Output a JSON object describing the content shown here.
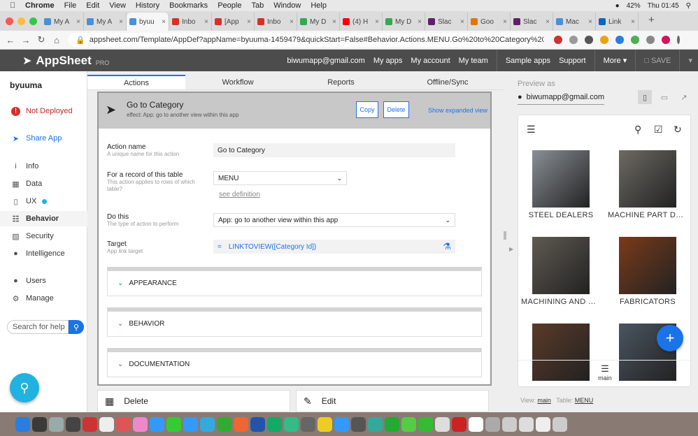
{
  "menubar": {
    "app": "Chrome",
    "items": [
      "File",
      "Edit",
      "View",
      "History",
      "Bookmarks",
      "People",
      "Tab",
      "Window",
      "Help"
    ],
    "battery": "42%",
    "clock": "Thu 01:45"
  },
  "tabs": [
    {
      "label": "My A",
      "color": "#4a90d9"
    },
    {
      "label": "My A",
      "color": "#4a90d9"
    },
    {
      "label": "byuu",
      "color": "#4a90d9",
      "active": true
    },
    {
      "label": "Inbo",
      "color": "#d93025"
    },
    {
      "label": "[App",
      "color": "#d93025"
    },
    {
      "label": "Inbo",
      "color": "#d93025"
    },
    {
      "label": "My D",
      "color": "#34a853"
    },
    {
      "label": "(4) H",
      "color": "#ff0000"
    },
    {
      "label": "My D",
      "color": "#34a853"
    },
    {
      "label": "Slac",
      "color": "#611f69"
    },
    {
      "label": "Goo",
      "color": "#e37400"
    },
    {
      "label": "Slac",
      "color": "#611f69"
    },
    {
      "label": "Mac",
      "color": "#4a90d9"
    },
    {
      "label": "Link",
      "color": "#0a66c2"
    }
  ],
  "address": {
    "url": "appsheet.com/Template/AppDef?appName=byuuma-1459479&quickStart=False#Behavior.Actions.MENU.Go%20to%20Category%20"
  },
  "header": {
    "brand": "AppSheet",
    "tier": "PRO",
    "email": "biwumapp@gmail.com",
    "nav": [
      "My apps",
      "My account",
      "My team",
      "Sample apps",
      "Support",
      "More ▾"
    ],
    "save": "SAVE"
  },
  "sidebar": {
    "app_name": "byuuma",
    "status": "Not Deployed",
    "share": "Share App",
    "items": [
      "Info",
      "Data",
      "UX",
      "Behavior",
      "Security",
      "Intelligence",
      "Users",
      "Manage"
    ],
    "search_placeholder": "Search for help"
  },
  "editor": {
    "tabs": [
      "Actions",
      "Workflow",
      "Reports",
      "Offline/Sync"
    ],
    "action": {
      "title": "Go to Category",
      "effect": "effect: App: go to another view within this app",
      "copy": "Copy",
      "delete": "Delete",
      "expand": "Show expanded view"
    },
    "fields": {
      "name_label": "Action name",
      "name_desc": "A unique name for this action",
      "name_value": "Go to Category",
      "table_label": "For a record of this table",
      "table_desc": "This action applies to rows of which table?",
      "table_value": "MENU",
      "see_def": "see definition",
      "do_label": "Do this",
      "do_desc": "The type of action to perform",
      "do_value": "App: go to another view within this app",
      "target_label": "Target",
      "target_desc": "App link target",
      "target_value": "LINKTOVIEW([Category Id])"
    },
    "sections": [
      "APPEARANCE",
      "BEHAVIOR",
      "DOCUMENTATION"
    ],
    "bottom": [
      "Delete",
      "Edit"
    ]
  },
  "preview": {
    "label": "Preview as",
    "user": "biwumapp@gmail.com",
    "tiles": [
      {
        "label": "STEEL DEALERS",
        "color": "#8a9096"
      },
      {
        "label": "MACHINE PART DE...",
        "color": "#6d6a63"
      },
      {
        "label": "MACHINING AND MI...",
        "color": "#5f5a52"
      },
      {
        "label": "FABRICATORS",
        "color": "#7b3a1a"
      },
      {
        "label": "",
        "color": "#5a3a28"
      },
      {
        "label": "",
        "color": "#4a5560"
      }
    ],
    "bottom_nav": "main",
    "view_label": "View:",
    "view_value": "main",
    "table_label": "Table:",
    "table_value": "MENU"
  },
  "dock": [
    "#2a7de1",
    "#3a3a3a",
    "#9aa",
    "#444",
    "#c33",
    "#eee",
    "#d55",
    "#e8c",
    "#39f",
    "#3c3",
    "#39f",
    "#3ad",
    "#3a3",
    "#e63",
    "#25a",
    "#1a6",
    "#3b8",
    "#666",
    "#ec2",
    "#39f",
    "#555",
    "#3a9",
    "#2a3",
    "#5c4",
    "#3b3",
    "#ddd",
    "#c22",
    "#fff",
    "#aaa",
    "#ccc",
    "#ddd",
    "#eee",
    "#ccc"
  ]
}
